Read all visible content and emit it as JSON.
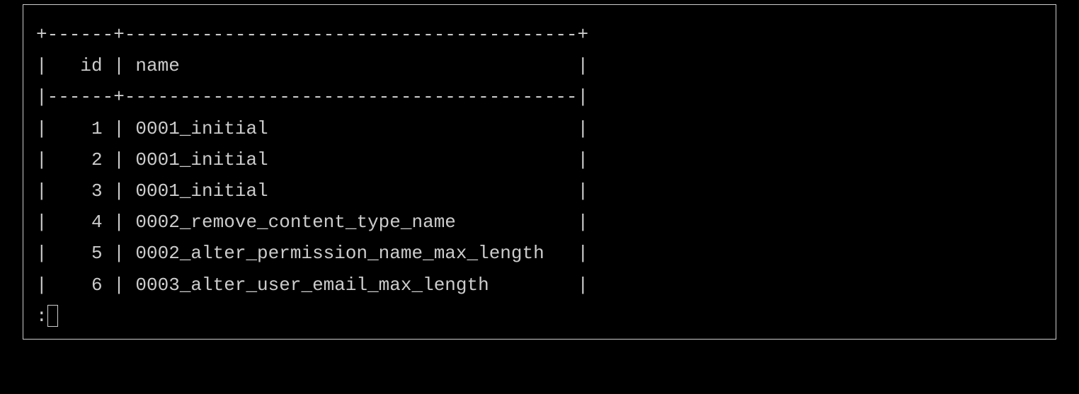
{
  "table": {
    "id_col_width": 6,
    "name_col_width": 41,
    "headers": {
      "id": "id",
      "name": "name"
    },
    "rows": [
      {
        "id": 1,
        "name": "0001_initial"
      },
      {
        "id": 2,
        "name": "0001_initial"
      },
      {
        "id": 3,
        "name": "0001_initial"
      },
      {
        "id": 4,
        "name": "0002_remove_content_type_name"
      },
      {
        "id": 5,
        "name": "0002_alter_permission_name_max_length"
      },
      {
        "id": 6,
        "name": "0003_alter_user_email_max_length"
      }
    ]
  },
  "prompt": {
    "symbol": ":"
  }
}
